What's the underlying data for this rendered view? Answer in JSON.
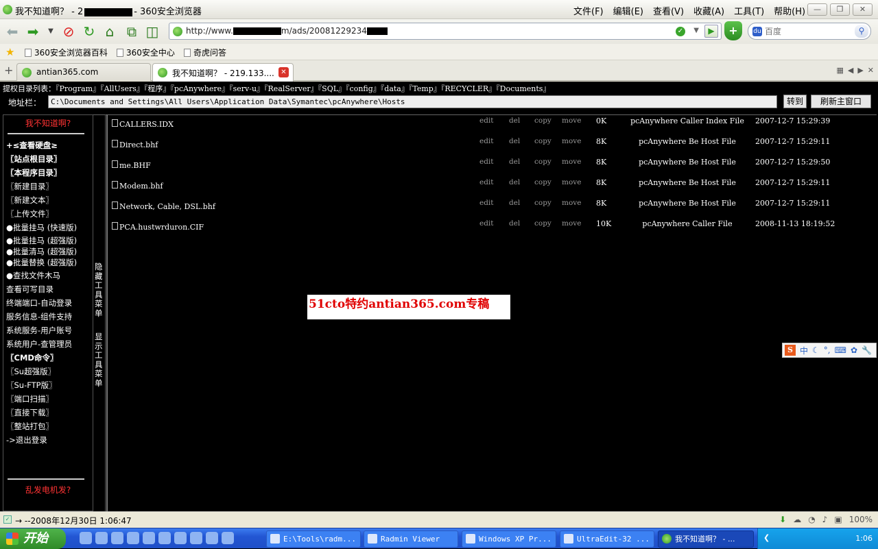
{
  "window": {
    "title_prefix": "我不知道啊？ - 2",
    "title_suffix": "- 360安全浏览器",
    "menu": [
      "文件(F)",
      "编辑(E)",
      "查看(V)",
      "收藏(A)",
      "工具(T)",
      "帮助(H)"
    ]
  },
  "nav": {
    "url_prefix": "http://www.",
    "url_mid": "m/ads/20081229234",
    "search_placeholder": "百度"
  },
  "favorites": [
    "360安全浏览器百科",
    "360安全中心",
    "奇虎问答"
  ],
  "tabs": [
    {
      "label": "antian365.com"
    },
    {
      "label": "我不知道啊？ - 219.133...."
    }
  ],
  "page": {
    "dirs": "提权目录列表：『Program』『AllUsers』『程序』『pcAnywhere』『serv-u』『RealServer』『SQL』『config』『data』『Temp』『RECYCLER』『Documents』",
    "addr_label": "地址栏：",
    "addr_value": "C:\\Documents and Settings\\All Users\\Application Data\\Symantec\\pcAnywhere\\Hosts",
    "goto_label": "转到",
    "refresh_label": "刷新主窗口",
    "sidebar_top": "我不知道啊?",
    "sidebar_bottom": "乱发电机发?",
    "sidebar_items": [
      {
        "label": "+≤查看硬盘≥",
        "bold": true
      },
      {
        "label": "〖站点根目录〗",
        "bold": true
      },
      {
        "label": "〖本程序目录〗",
        "bold": true
      },
      {
        "label": "〖新建目录〗",
        "bold": false
      },
      {
        "label": "〖新建文本〗",
        "bold": false
      },
      {
        "label": "〖上传文件〗",
        "bold": false
      },
      {
        "label": "●批量挂马 (快速版)",
        "bold": false
      },
      {
        "label": "●批量挂马 (超强版)",
        "bold": false,
        "two": true
      },
      {
        "label": "●批量清马 (超强版)",
        "bold": false,
        "two": true
      },
      {
        "label": "●批量替换 (超强版)",
        "bold": false,
        "two": true
      },
      {
        "label": "●查找文件木马",
        "bold": false
      },
      {
        "label": "查看可写目录",
        "bold": false
      },
      {
        "label": "终端端口-自动登录",
        "bold": false
      },
      {
        "label": "服务信息-组件支持",
        "bold": false
      },
      {
        "label": "系统服务-用户账号",
        "bold": false
      },
      {
        "label": "系统用户-查管理员",
        "bold": false
      },
      {
        "label": "〖CMD命令〗",
        "bold": true
      },
      {
        "label": "〖Su超强版〗",
        "bold": false
      },
      {
        "label": "〖Su-FTP版〗",
        "bold": false
      },
      {
        "label": "〖端口扫描〗",
        "bold": false
      },
      {
        "label": "〖直接下载〗",
        "bold": false
      },
      {
        "label": "〖整站打包〗",
        "bold": false
      },
      {
        "label": "->退出登录",
        "bold": false
      }
    ],
    "toggle_hide": "隐藏工具菜单",
    "toggle_show": "显示工具菜单",
    "actions": [
      "edit",
      "del",
      "copy",
      "move"
    ],
    "files": [
      {
        "name": "CALLERS.IDX",
        "size": "0K",
        "type": "pcAnywhere Caller Index File",
        "date": "2007-12-7 15:29:39"
      },
      {
        "name": "Direct.bhf",
        "size": "8K",
        "type": "pcAnywhere Be Host File",
        "date": "2007-12-7 15:29:11"
      },
      {
        "name": "me.BHF",
        "size": "8K",
        "type": "pcAnywhere Be Host File",
        "date": "2007-12-7 15:29:50"
      },
      {
        "name": "Modem.bhf",
        "size": "8K",
        "type": "pcAnywhere Be Host File",
        "date": "2007-12-7 15:29:11"
      },
      {
        "name": "Network, Cable, DSL.bhf",
        "size": "8K",
        "type": "pcAnywhere Be Host File",
        "date": "2007-12-7 15:29:11"
      },
      {
        "name": "PCA.hustwrduron.CIF",
        "size": "10K",
        "type": "pcAnywhere Caller File",
        "date": "2008-11-13 18:19:52"
      }
    ],
    "watermark": "51cto特约antian365.com专稿",
    "ime_text": "中"
  },
  "status": {
    "text": "→  --2008年12月30日 1:06:47",
    "zoom": "100%"
  },
  "taskbar": {
    "start": "开始",
    "tasks": [
      {
        "label": "E:\\Tools\\radm..."
      },
      {
        "label": "Radmin Viewer"
      },
      {
        "label": "Windows XP Pr..."
      },
      {
        "label": "UltraEdit-32 ..."
      },
      {
        "label": "我不知道啊？ - ..."
      }
    ],
    "clock": "1:06"
  }
}
